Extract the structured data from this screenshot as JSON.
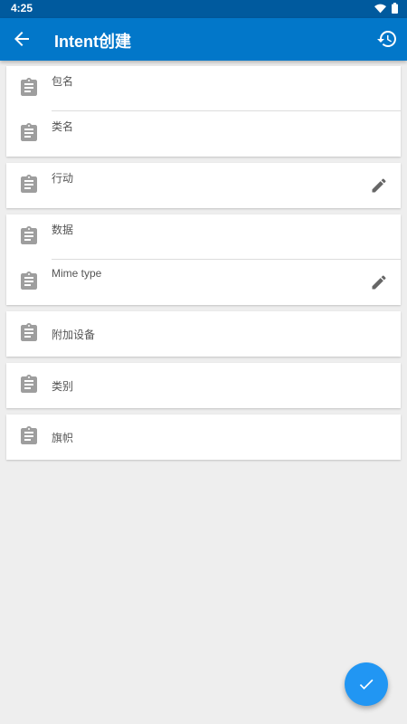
{
  "status_bar": {
    "time": "4:25",
    "icons": [
      "wifi-icon",
      "battery-icon"
    ]
  },
  "app_bar": {
    "title": "Intent创建",
    "back_icon": "arrow-left-icon",
    "history_icon": "history-icon"
  },
  "fields": {
    "package_name": "包名",
    "class_name": "类名",
    "action": "行动",
    "data": "数据",
    "mime_type": "Mime type",
    "extras": "附加设备",
    "category": "类别",
    "flags": "旗帜"
  },
  "fab": {
    "icon": "check-icon"
  },
  "colors": {
    "appbar": "#0277c9",
    "statusbar": "#005a9e",
    "fab": "#2196f3",
    "background": "#eeeeee"
  }
}
